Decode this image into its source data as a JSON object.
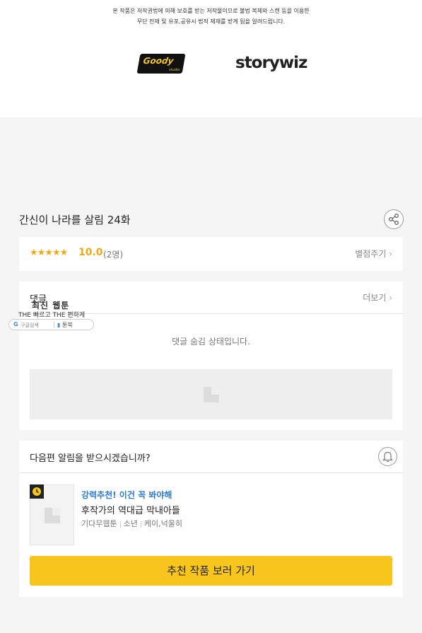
{
  "footer": {
    "notice_line1": "본 작품은 저작권법에 의해 보호를 받는 저작물이므로 불법 복제와 스캔 등을 이용한",
    "notice_line2": "무단 전재 및 유포,공유시 법적 제재를 받게 됨을 알려드립니다.",
    "logo_goody": "Goody",
    "logo_goody_sub": "studio",
    "logo_story": "storywiz"
  },
  "episode": {
    "title": "간신이 나라를 살림 24화",
    "share_icon": "share-icon"
  },
  "rating": {
    "stars": "★★★★★",
    "score": "10.0",
    "count": "(2명)",
    "rate_button": "별점주기",
    "accent": "#f3a712"
  },
  "comments": {
    "title": "댓글",
    "more": "더보기",
    "hidden_message": "댓글 숨김 상태입니다."
  },
  "overlay": {
    "title": "최신 웹툰",
    "sub": "THE 빠르고 THE 편하게",
    "google_label": "G",
    "google_search": "구글검색",
    "toonbook": "툰북"
  },
  "notify": {
    "question": "다음편 알림을 받으시겠습니까?",
    "rec_label": "강력추천! 이건 꼭 봐야해",
    "rec_title": "후작가의 역대급 막내아들",
    "meta_publisher": "기다무웹툰",
    "meta_genre": "소년",
    "meta_author": "케이,넉울히",
    "go_button": "추천 작품 보러 가기",
    "button_color": "#f8c51d",
    "label_color": "#2b7bd8"
  }
}
